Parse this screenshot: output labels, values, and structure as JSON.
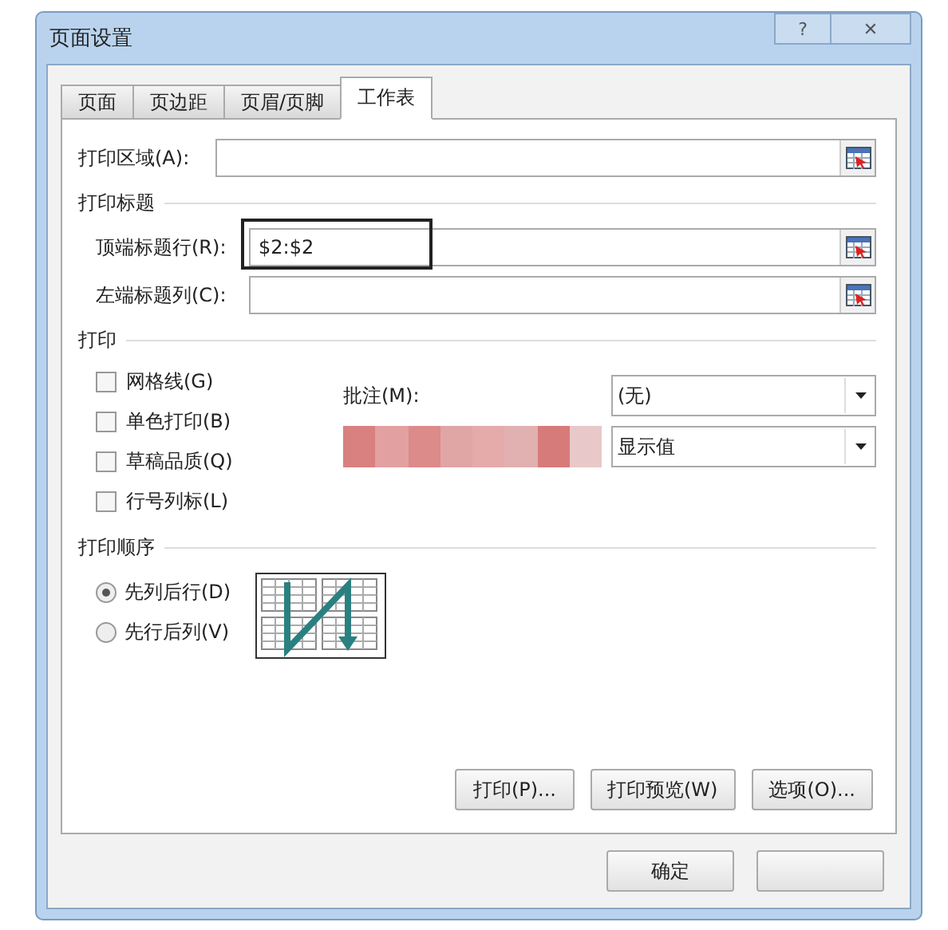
{
  "window": {
    "title": "页面设置",
    "title_buttons": [
      {
        "kind": "help",
        "label": "?"
      },
      {
        "kind": "close",
        "label": "✕"
      }
    ]
  },
  "tabs": [
    {
      "label": "页面",
      "selected": false
    },
    {
      "label": "页边距",
      "selected": false
    },
    {
      "label": "页眉/页脚",
      "selected": false
    },
    {
      "label": "工作表",
      "selected": true
    }
  ],
  "print_area": {
    "label": "打印区域(A):"
  },
  "print_titles": {
    "heading": "打印标题",
    "fields": [
      {
        "label": "顶端标题行(R):",
        "value": "$2:$2",
        "highlighted": true
      },
      {
        "label": "左端标题列(C):",
        "highlighted": false
      }
    ]
  },
  "print": {
    "heading": "打印",
    "checkboxes": [
      {
        "label": "网格线(G)",
        "checked": false
      },
      {
        "label": "单色打印(B)",
        "checked": false
      },
      {
        "label": "草稿品质(Q)",
        "checked": false
      },
      {
        "label": "行号列标(L)",
        "checked": false
      }
    ],
    "dropdowns": [
      {
        "kind": "labelled",
        "label": "批注(M):",
        "value": "(无)"
      },
      {
        "kind": "redacted",
        "value": "显示值"
      }
    ]
  },
  "page_order": {
    "heading": "打印顺序",
    "options": [
      {
        "label": "先列后行(D)",
        "selected": true
      },
      {
        "label": "先行后列(V)",
        "selected": false
      }
    ]
  },
  "panel_buttons": [
    "打印(P)...",
    "打印预览(W)",
    "选项(O)..."
  ],
  "footer_buttons": [
    {
      "kind": "text",
      "label": "确定"
    },
    {
      "kind": "blank"
    }
  ]
}
